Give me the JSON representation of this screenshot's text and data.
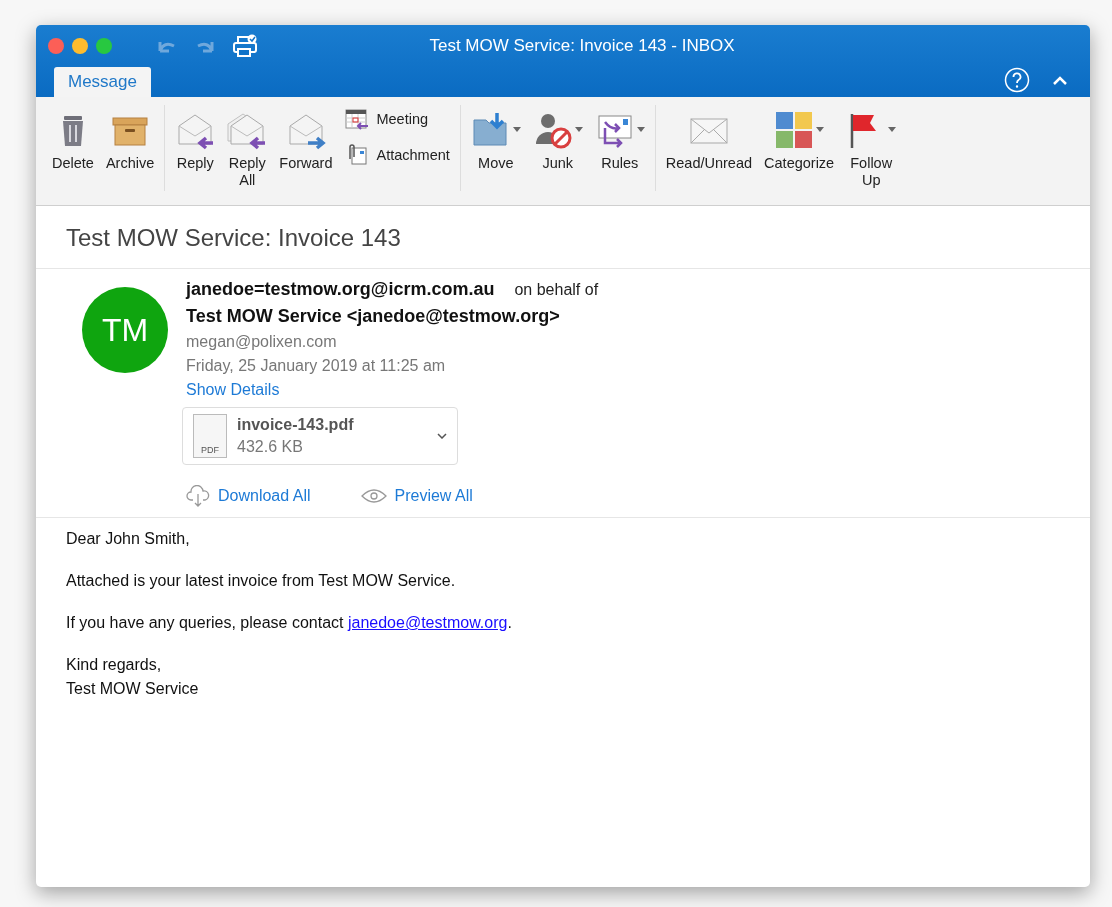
{
  "window": {
    "title": "Test MOW Service: Invoice 143 - INBOX"
  },
  "tabs": [
    {
      "label": "Message",
      "selected": true
    }
  ],
  "ribbon": {
    "groups": [
      {
        "buttons": [
          {
            "kind": "large",
            "label": "Delete",
            "dropdown": false
          },
          {
            "kind": "large",
            "label": "Archive",
            "dropdown": false
          }
        ]
      },
      {
        "buttons": [
          {
            "kind": "large",
            "label": "Reply",
            "dropdown": false
          },
          {
            "kind": "large",
            "label": "Reply All",
            "dropdown": false
          },
          {
            "kind": "large",
            "label": "Forward",
            "dropdown": false
          },
          {
            "kind": "small",
            "label": "Meeting",
            "dropdown": false
          },
          {
            "kind": "small",
            "label": "Attachment",
            "dropdown": false
          }
        ]
      },
      {
        "buttons": [
          {
            "kind": "large",
            "label": "Move",
            "dropdown": true
          },
          {
            "kind": "large",
            "label": "Junk",
            "dropdown": true
          },
          {
            "kind": "large",
            "label": "Rules",
            "dropdown": true
          }
        ]
      },
      {
        "buttons": [
          {
            "kind": "large",
            "label": "Read/Unread",
            "dropdown": false
          },
          {
            "kind": "large",
            "label": "Categorize",
            "dropdown": true
          },
          {
            "kind": "large",
            "label": "Follow Up",
            "dropdown": true
          }
        ]
      }
    ]
  },
  "message": {
    "subject": "Test MOW Service: Invoice 143",
    "avatar_initials": "TM",
    "from": "janedoe=testmow.org@icrm.com.au",
    "behalf": "on behalf of",
    "sender": "Test MOW Service <janedoe@testmow.org>",
    "to": "megan@polixen.com",
    "date": "Friday, 25 January 2019 at 11:25 am",
    "show_details": "Show Details",
    "attachment": {
      "icon_label": "PDF",
      "name": "invoice-143.pdf",
      "size": "432.6 KB"
    },
    "actions": [
      {
        "kind": "download",
        "label": "Download All"
      },
      {
        "kind": "preview",
        "label": "Preview All"
      }
    ],
    "body": [
      {
        "text": "Dear John Smith,"
      },
      {
        "text": "Attached is your latest invoice from Test MOW Service."
      },
      {
        "text": "If you have any queries, please contact ",
        "link": "janedoe@testmow.org",
        "after": "."
      },
      {
        "lines": [
          "Kind regards,",
          "Test MOW Service"
        ]
      }
    ]
  }
}
